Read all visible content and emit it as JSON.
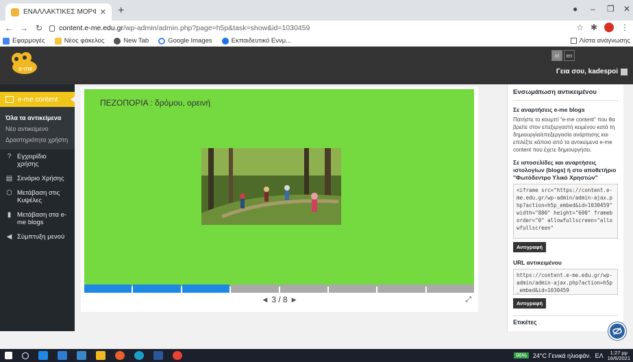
{
  "browser": {
    "tab_title": "ΕΝΑΛΛΑΚΤΙΚΕΣ ΜΟΡΦΕΣ ΑΣΚΗΣ",
    "url_host": "content.e-me.edu.gr",
    "url_path": "/wp-admin/admin.php?page=h5p&task=show&id=1030459",
    "bookmarks": [
      "Εφαρμογές",
      "Νέος φάκελος",
      "New Tab",
      "Google Images",
      "Εκπαιδευτικό Εννμ..."
    ],
    "reading_list": "Λίστα ανάγνωσης"
  },
  "wpbar": {
    "logo_text": "e-me",
    "lang_el": "el",
    "lang_en": "en",
    "greeting": "Γεια σου, kadespoi"
  },
  "sidebar": {
    "head": "e-me content",
    "sub": [
      "Όλα τα αντικείμενα",
      "Νέο αντικείμενο",
      "Δραστηριότητα χρήστη"
    ],
    "items": [
      "Εγχειρίδιο χρήσης",
      "Σενάριο Χρήσης",
      "Μετάβαση στις Κυψέλες",
      "Μετάβαση στα e-me blogs",
      "Σύμπτυξη μενού"
    ]
  },
  "slide": {
    "title": "ΠΕΖΟΠΟΡΙΑ : δρόμου, ορεινή",
    "current": 3,
    "total": 8,
    "pager_text": "3 / 8",
    "segments_total": 8,
    "segments_done": 3,
    "bg_color": "#75d940",
    "progress_color": "#1e88e5"
  },
  "rpanel": {
    "title": "Ενσωμάτωση αντικειμένου",
    "blogs_heading": "Σε αναρτήσεις e-me blogs",
    "blogs_text": "Πατήστε το κουμπί \"e-me content\" που θα βρείτε στον επεξεργαστή κειμένου κατά τη δημιουργία/επεξεργασία ανάρτησης και επιλέξτε κάποιο από τα αντικείμενα e-me content που έχετε δημιουργήσει.",
    "sites_heading": "Σε ιστοσελίδες και αναρτήσεις ιστολογίων (blogs) ή στο αποθετήριο \"Φωτόδεντρο Υλικό Χρηστών\"",
    "iframe_code": "<iframe src=\"https://content.e-me.edu.gr/wp-admin/admin-ajax.php?action=h5p_embed&id=1030459\" width=\"800\" height=\"600\" frameborder=\"0\" allowfullscreen=\"allowfullscreen\"",
    "copy_label": "Αντιγραφή",
    "url_heading": "URL αντικειμένου",
    "url_value": "https://content.e-me.edu.gr/wp-admin/admin-ajax.php?action=h5p_embed&id=1030459",
    "copy_label2": "Αντιγραφή",
    "more_heading": "Ετικέτες"
  },
  "taskbar": {
    "battery": "96%",
    "weather": "24°C Γενικά ηλιοφάν.",
    "lang": "ΕΛ",
    "time": "1:27 μμ",
    "date": "16/6/2021"
  }
}
